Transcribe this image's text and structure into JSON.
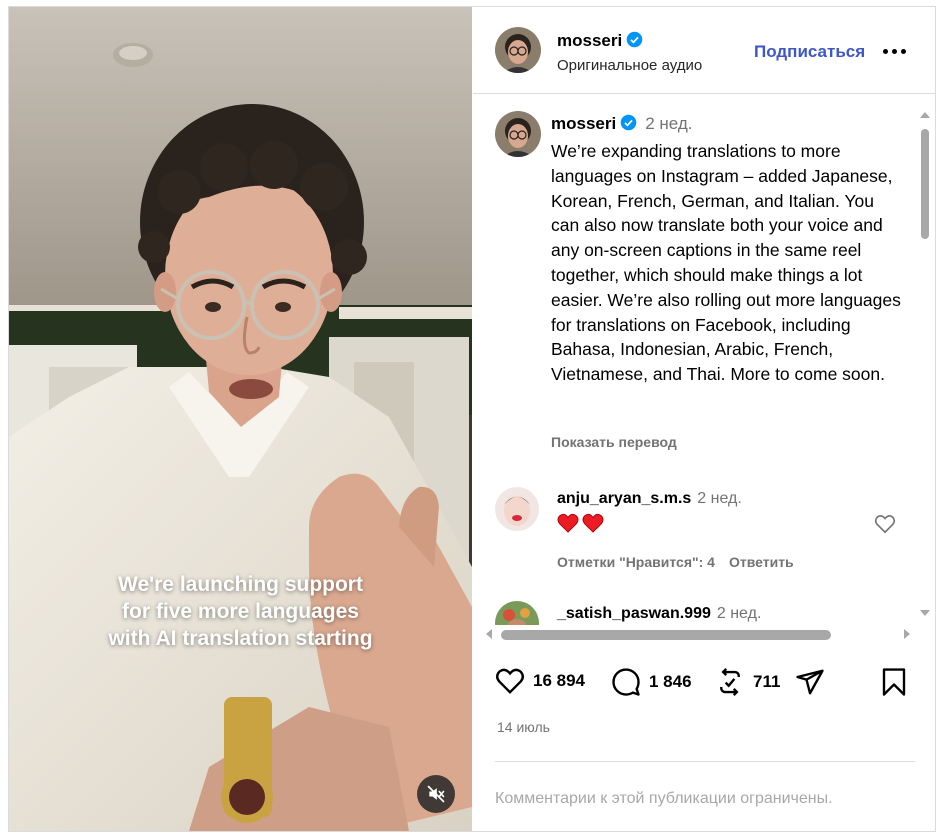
{
  "video": {
    "caption_lines": [
      "We're launching support",
      "for five more languages",
      "with AI translation starting"
    ],
    "mute_icon": "speaker-muted-icon"
  },
  "header": {
    "username": "mosseri",
    "subtitle": "Оригинальное аудио",
    "follow_label": "Подписаться",
    "more_icon": "more-horizontal-icon"
  },
  "post": {
    "username": "mosseri",
    "time": "2 нед.",
    "text": "We’re expanding translations to more languages on Instagram – added Japanese, Korean, French, German, and Italian. You can also now translate both your voice and any on-screen captions in the same reel together, which should make things a lot easier. We’re also rolling out more languages for translations on Facebook, including Bahasa, Indonesian, Arabic, French, Vietnamese, and Thai. More to come soon.",
    "translate_label": "Показать перевод"
  },
  "comments": [
    {
      "username": "anju_aryan_s.m.s",
      "time": "2 нед.",
      "text_icons": [
        "red-heart-emoji",
        "red-heart-emoji"
      ],
      "likes_label": "Отметки \"Нравится\": 4",
      "reply_label": "Ответить"
    },
    {
      "username": "_satish_paswan.999",
      "time": "2 нед."
    }
  ],
  "actions": {
    "likes": "16 894",
    "comments": "1 846",
    "reposts": "711"
  },
  "date": "14 июль",
  "footer_text": "Комментарии к этой публикации ограничены.",
  "colors": {
    "accent": "#3e56c8",
    "secondary_text": "#737373",
    "verified": "#0095f6",
    "heart": "#ed1c24"
  }
}
